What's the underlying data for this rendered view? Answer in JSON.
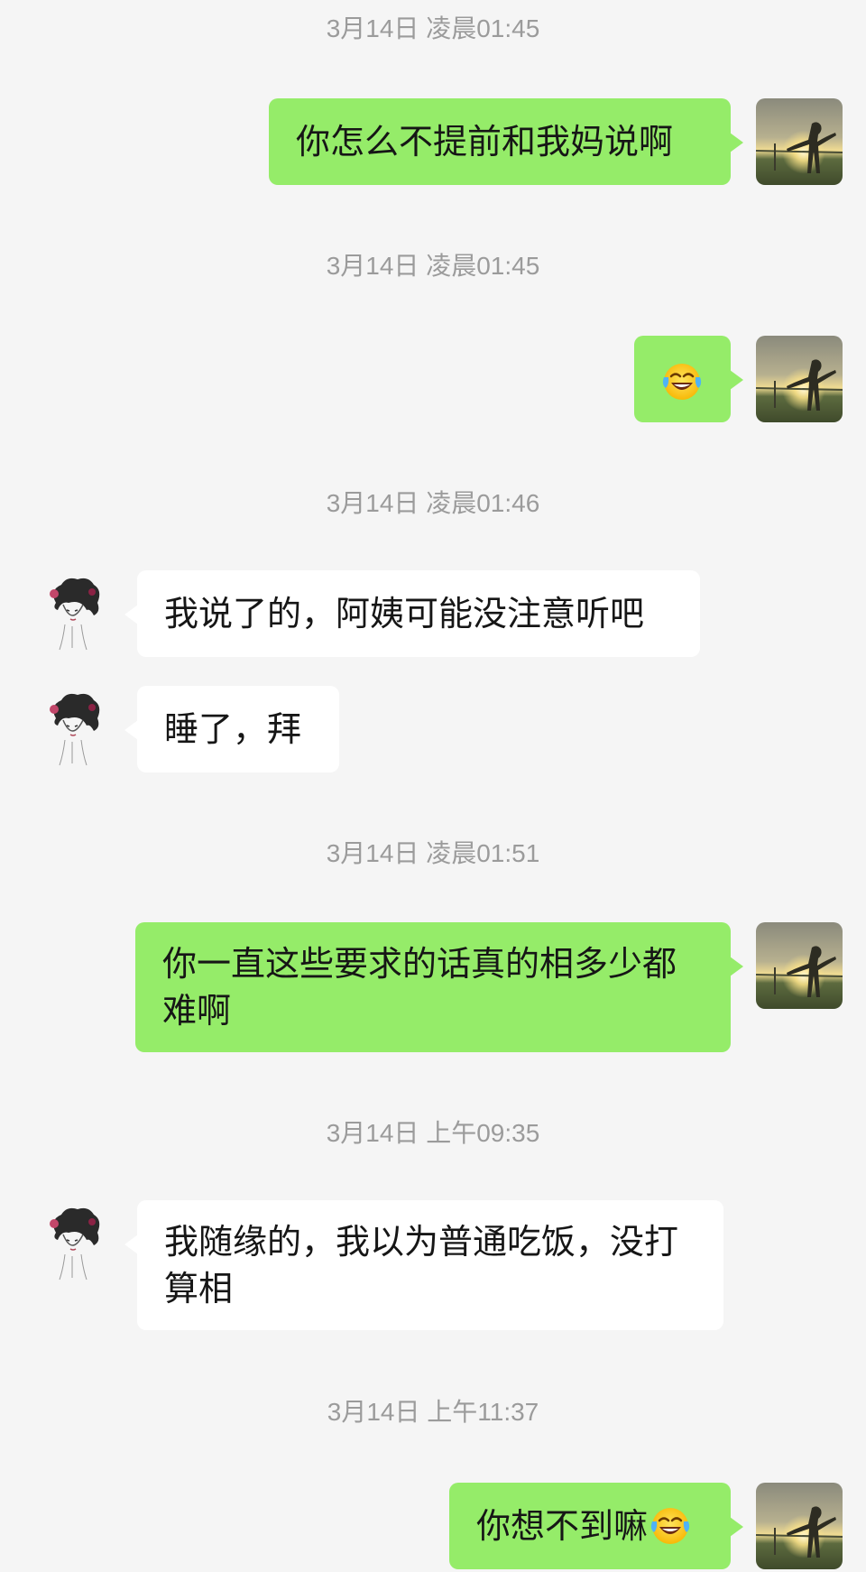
{
  "messages": [
    {
      "timestamp": "3月14日 凌晨01:45",
      "direction": "sent",
      "text": "你怎么不提前和我妈说啊"
    },
    {
      "timestamp": "3月14日 凌晨01:45",
      "direction": "sent",
      "text": "",
      "emoji": "laughing-tears-emoji"
    },
    {
      "timestamp": "3月14日 凌晨01:46",
      "direction": "received",
      "text": "我说了的，阿姨可能没注意听吧"
    },
    {
      "direction": "received",
      "text": "睡了，拜"
    },
    {
      "timestamp": "3月14日 凌晨01:51",
      "direction": "sent",
      "text": "你一直这些要求的话真的相多少都难啊"
    },
    {
      "timestamp": "3月14日 上午09:35",
      "direction": "received",
      "text": "我随缘的，我以为普通吃饭，没打算相"
    },
    {
      "timestamp": "3月14日 上午11:37",
      "direction": "sent",
      "text": "你想不到嘛",
      "emoji": "laughing-tears-emoji"
    }
  ],
  "colors": {
    "background": "#f5f5f5",
    "sent_bubble": "#95ec69",
    "received_bubble": "#ffffff",
    "timestamp_text": "#9b9b9b"
  },
  "icons": {
    "self_avatar": "sunset-silhouette-avatar",
    "other_avatar": "ink-portrait-avatar"
  }
}
